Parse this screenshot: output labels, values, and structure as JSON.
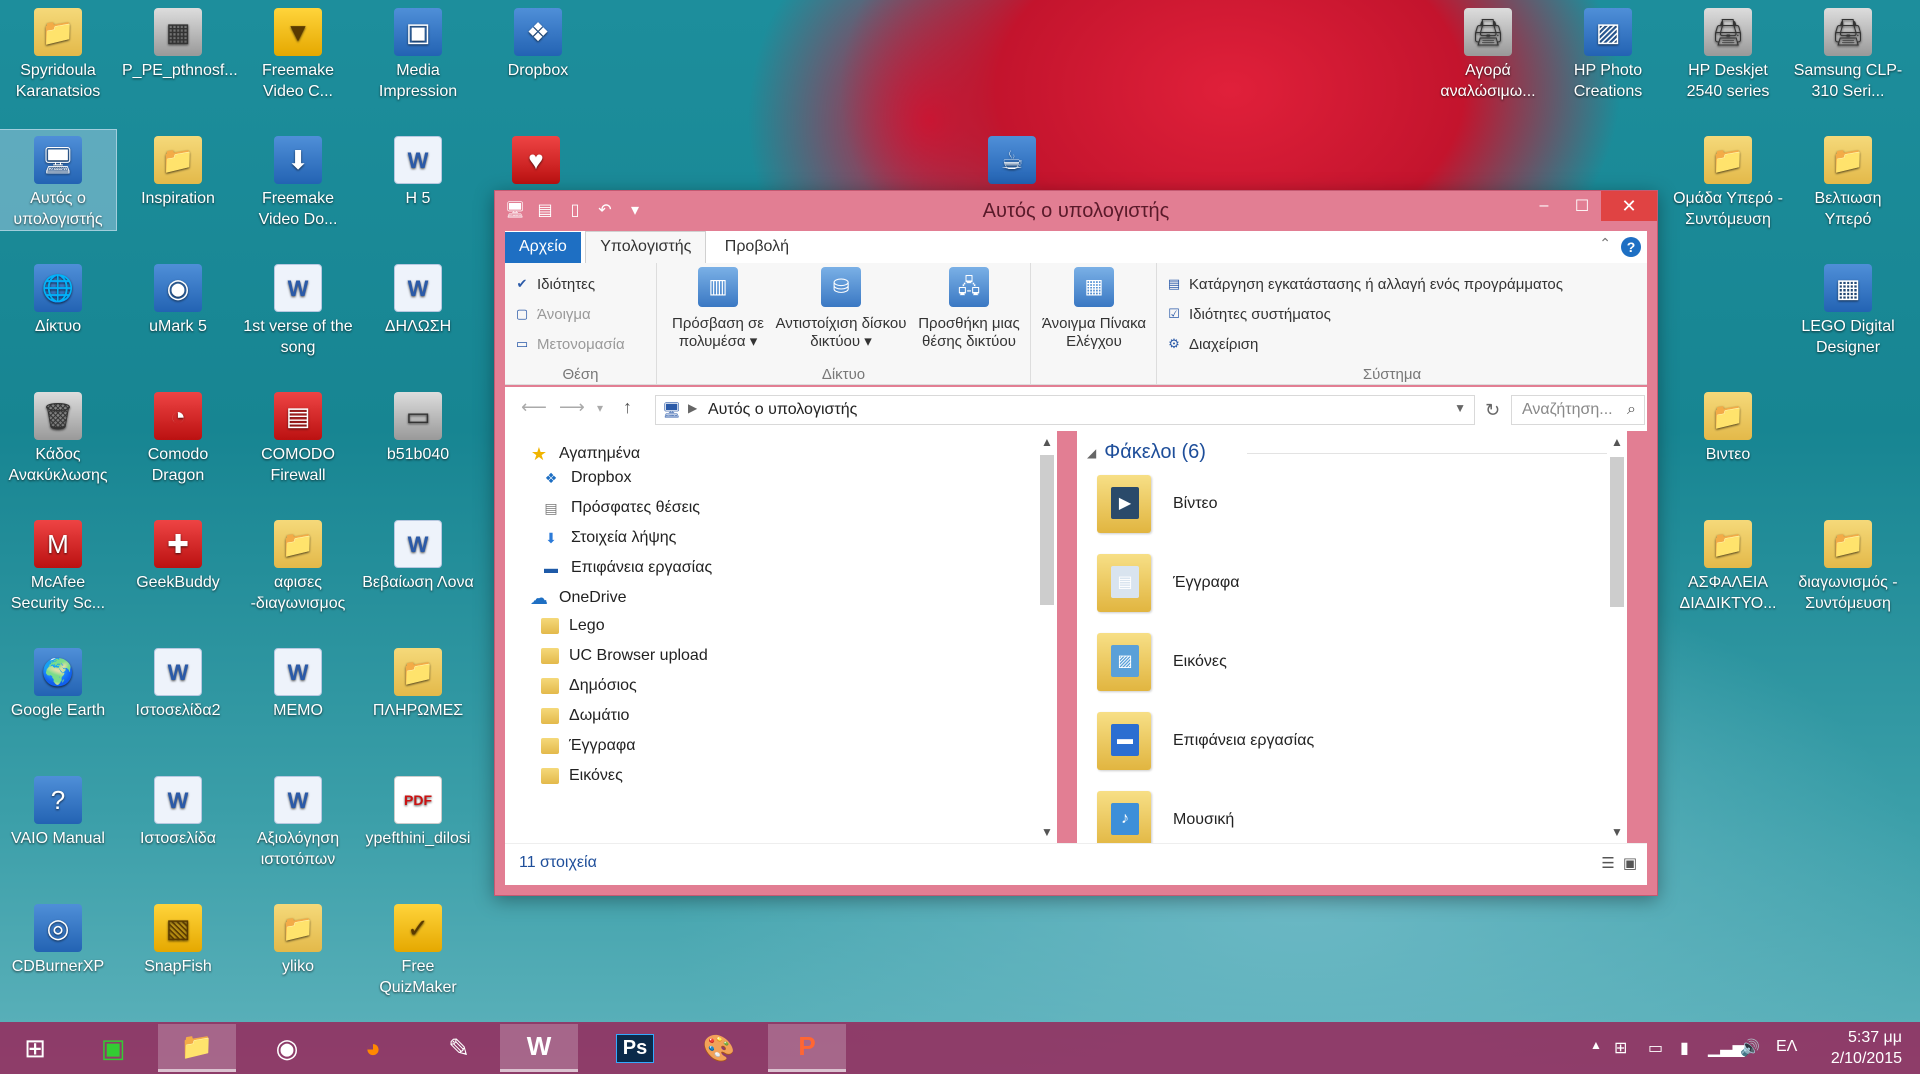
{
  "desktop_icons": [
    {
      "label": "Spyridoula Karanatsios",
      "kind": "folder",
      "glyph": "📁"
    },
    {
      "label": "P_PE_pthnosf...",
      "kind": "gray",
      "glyph": "▦"
    },
    {
      "label": "Freemake Video C...",
      "kind": "yellow",
      "glyph": "▼"
    },
    {
      "label": "Media Impression",
      "kind": "app",
      "glyph": "▣"
    },
    {
      "label": "Dropbox",
      "kind": "app",
      "glyph": "❖"
    },
    {
      "label": "Αυτός ο υπολογιστής",
      "kind": "app",
      "glyph": "🖥"
    },
    {
      "label": "Inspiration",
      "kind": "folder",
      "glyph": "📁"
    },
    {
      "label": "Freemake Video Do...",
      "kind": "app",
      "glyph": "⬇"
    },
    {
      "label": "Η 5",
      "kind": "word",
      "glyph": "W"
    },
    {
      "label": "",
      "kind": "red",
      "glyph": "♥"
    },
    {
      "label": "Δίκτυο",
      "kind": "app",
      "glyph": "🌐"
    },
    {
      "label": "uMark 5",
      "kind": "app",
      "glyph": "◉"
    },
    {
      "label": "1st verse of the song",
      "kind": "word",
      "glyph": "W"
    },
    {
      "label": "ΔΗΛΩΣΗ",
      "kind": "word",
      "glyph": "W"
    },
    {
      "label": "Κάδος Ανακύκλωσης",
      "kind": "gray",
      "glyph": "🗑"
    },
    {
      "label": "Comodo Dragon",
      "kind": "red",
      "glyph": "◔"
    },
    {
      "label": "COMODO Firewall",
      "kind": "red",
      "glyph": "▤"
    },
    {
      "label": "b51b040",
      "kind": "gray",
      "glyph": "▭"
    },
    {
      "label": "McAfee Security Sc...",
      "kind": "red",
      "glyph": "M"
    },
    {
      "label": "GeekBuddy",
      "kind": "red",
      "glyph": "✚"
    },
    {
      "label": "αφισες -διαγωνισμος",
      "kind": "folder",
      "glyph": "📁"
    },
    {
      "label": "Βεβαίωση Λονα",
      "kind": "word",
      "glyph": "W"
    },
    {
      "label": "Google Earth",
      "kind": "app",
      "glyph": "🌍"
    },
    {
      "label": "Ιστοσελίδα2",
      "kind": "word",
      "glyph": "W"
    },
    {
      "label": "MEMO",
      "kind": "word",
      "glyph": "W"
    },
    {
      "label": "ΠΛΗΡΩΜΕΣ",
      "kind": "folder",
      "glyph": "📁"
    },
    {
      "label": "VAIO Manual",
      "kind": "app",
      "glyph": "?"
    },
    {
      "label": "Ιστοσελίδα",
      "kind": "word",
      "glyph": "W"
    },
    {
      "label": "Αξιολόγηση ιστοτόπων",
      "kind": "word",
      "glyph": "W"
    },
    {
      "label": "ypefthini_dilosi",
      "kind": "pdf",
      "glyph": "PDF"
    },
    {
      "label": "CDBurnerXP",
      "kind": "app",
      "glyph": "◎"
    },
    {
      "label": "SnapFish",
      "kind": "yellow",
      "glyph": "▧"
    },
    {
      "label": "yliko",
      "kind": "folder",
      "glyph": "📁"
    },
    {
      "label": "Free QuizMaker",
      "kind": "yellow",
      "glyph": "✓"
    },
    {
      "label": "",
      "kind": "app",
      "glyph": "☕"
    },
    {
      "label": "Αγορά αναλώσιμω...",
      "kind": "gray",
      "glyph": "🖨"
    },
    {
      "label": "HP Photo Creations",
      "kind": "app",
      "glyph": "▨"
    },
    {
      "label": "HP Deskjet 2540 series",
      "kind": "gray",
      "glyph": "🖨"
    },
    {
      "label": "Samsung CLP-310 Seri...",
      "kind": "gray",
      "glyph": "🖨"
    },
    {
      "label": "Ομάδα Υπερό - Συντόμευση",
      "kind": "folder",
      "glyph": "📁"
    },
    {
      "label": "Βελτιωση Υπερό",
      "kind": "folder",
      "glyph": "📁"
    },
    {
      "label": "LEGO Digital Designer",
      "kind": "app",
      "glyph": "▦"
    },
    {
      "label": "Βιντεο",
      "kind": "folder",
      "glyph": "📁"
    },
    {
      "label": "ΑΣΦΑΛΕΙΑ ΔΙΑΔΙΚΤΥΟ...",
      "kind": "folder",
      "glyph": "📁"
    },
    {
      "label": "διαγωνισμός - Συντόμευση",
      "kind": "folder",
      "glyph": "📁"
    }
  ],
  "window": {
    "title": "Αυτός ο υπολογιστής",
    "controls": {
      "minimize": "–",
      "maximize": "☐",
      "close": "✕"
    },
    "tabs": {
      "file": "Αρχείο",
      "computer": "Υπολογιστής",
      "view": "Προβολή"
    },
    "ribbon": {
      "location": {
        "name": "Θέση",
        "properties": "Ιδιότητες",
        "open": "Άνοιγμα",
        "rename": "Μετονομασία"
      },
      "network": {
        "name": "Δίκτυο",
        "access_media": "Πρόσβαση σε πολυμέσα ▾",
        "map_drive": "Αντιστοίχιση δίσκου δικτύου ▾",
        "add_location": "Προσθήκη μιας θέσης δικτύου"
      },
      "open_control_panel": "Άνοιγμα Πίνακα Ελέγχου",
      "system": {
        "name": "Σύστημα",
        "uninstall": "Κατάργηση εγκατάστασης ή αλλαγή ενός προγράμματος",
        "system_properties": "Ιδιότητες συστήματος",
        "manage": "Διαχείριση"
      }
    },
    "address": {
      "path": "Αυτός ο υπολογιστής",
      "search_placeholder": "Αναζήτηση..."
    },
    "nav_pane": {
      "favorites": "Αγαπημένα",
      "favorite_items": [
        "Dropbox",
        "Πρόσφατες θέσεις",
        "Στοιχεία λήψης",
        "Επιφάνεια εργασίας"
      ],
      "onedrive": "OneDrive",
      "onedrive_items": [
        "Lego",
        "UC Browser upload",
        "Δημόσιος",
        "Δωμάτιο",
        "Έγγραφα",
        "Εικόνες"
      ]
    },
    "content": {
      "group_header": "Φάκελοι (6)",
      "folders": [
        "Βίντεο",
        "Έγγραφα",
        "Εικόνες",
        "Επιφάνεια εργασίας",
        "Μουσική"
      ]
    },
    "status": "11 στοιχεία"
  },
  "taskbar": {
    "clock_time": "5:37 μμ",
    "clock_date": "2/10/2015",
    "language": "ΕΛ"
  },
  "colors": {
    "accent": "#1e6fc3",
    "window_frame": "#e27e93",
    "close": "#e04343"
  }
}
